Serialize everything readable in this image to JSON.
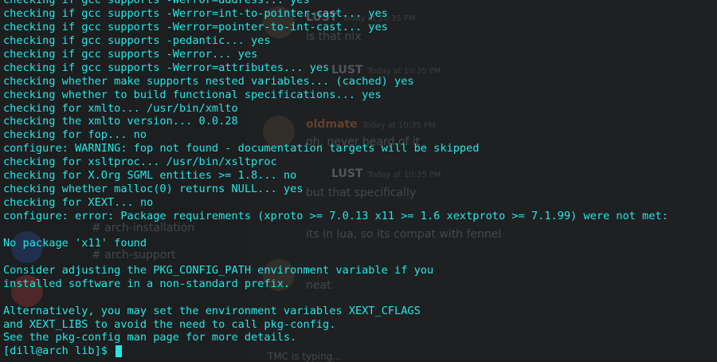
{
  "background_chat": {
    "channels": [
      "arch-installation",
      "arch-support"
    ],
    "messages": [
      {
        "author": "LUST",
        "time": "Today at 10:35 PM",
        "text": "is that nix"
      },
      {
        "author": "LUST",
        "time": "Today at 10:35 PM",
        "text": ""
      },
      {
        "author": "oldmate",
        "time": "Today at 10:35 PM",
        "text": "oh, never heard of it"
      },
      {
        "author": "LUST",
        "time": "Today at 10:35 PM",
        "text": "but that specifically"
      },
      {
        "author": "",
        "time": "",
        "text": "its in lua, so its compat with fennel"
      },
      {
        "author": "",
        "time": "",
        "text": "neat"
      }
    ],
    "typing": "TMC is typing..."
  },
  "terminal": {
    "lines": [
      "checking if gcc supports -Werror=address... yes",
      "checking if gcc supports -Werror=int-to-pointer-cast... yes",
      "checking if gcc supports -Werror=pointer-to-int-cast... yes",
      "checking if gcc supports -pedantic... yes",
      "checking if gcc supports -Werror... yes",
      "checking if gcc supports -Werror=attributes... yes",
      "checking whether make supports nested variables... (cached) yes",
      "checking whether to build functional specifications... yes",
      "checking for xmlto... /usr/bin/xmlto",
      "checking the xmlto version... 0.0.28",
      "checking for fop... no",
      "configure: WARNING: fop not found - documentation targets will be skipped",
      "checking for xsltproc... /usr/bin/xsltproc",
      "checking for X.Org SGML entities >= 1.8... no",
      "checking whether malloc(0) returns NULL... yes",
      "checking for XEXT... no",
      "configure: error: Package requirements (xproto >= 7.0.13 x11 >= 1.6 xextproto >= 7.1.99) were not met:",
      "",
      "No package 'x11' found",
      "",
      "Consider adjusting the PKG_CONFIG_PATH environment variable if you",
      "installed software in a non-standard prefix.",
      "",
      "Alternatively, you may set the environment variables XEXT_CFLAGS",
      "and XEXT_LIBS to avoid the need to call pkg-config.",
      "See the pkg-config man page for more details."
    ],
    "prompt": "[dill@arch lib]$ ",
    "colors": {
      "text": "#22e8e6",
      "background": "#1a1c1e"
    }
  }
}
